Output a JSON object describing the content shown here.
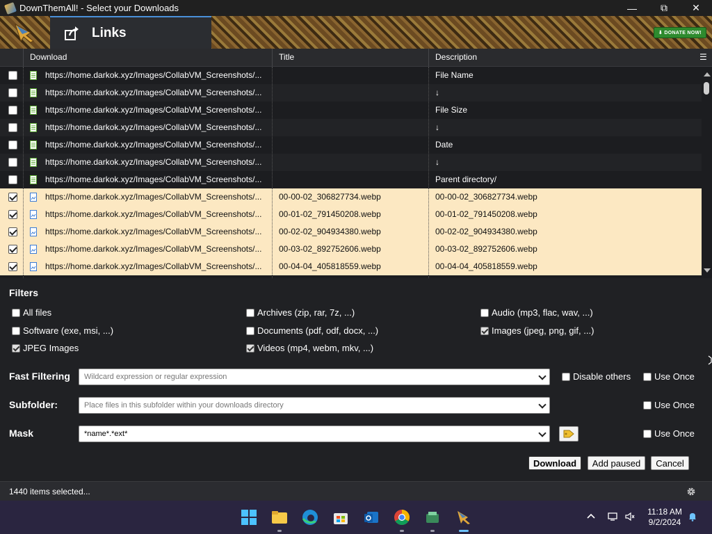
{
  "window": {
    "title": "DownThemAll! - Select your Downloads"
  },
  "banner": {
    "tab_label": "Links",
    "donate_label": "DONATE NOW!"
  },
  "table": {
    "columns": [
      "Download",
      "Title",
      "Description"
    ],
    "rows": [
      {
        "url": "https://home.darkok.xyz/Images/CollabVM_Screenshots/...",
        "title": "",
        "desc": "File Name",
        "checked": false,
        "type": "doc"
      },
      {
        "url": "https://home.darkok.xyz/Images/CollabVM_Screenshots/...",
        "title": "",
        "desc": "↓",
        "checked": false,
        "type": "doc"
      },
      {
        "url": "https://home.darkok.xyz/Images/CollabVM_Screenshots/...",
        "title": "",
        "desc": "File Size",
        "checked": false,
        "type": "doc"
      },
      {
        "url": "https://home.darkok.xyz/Images/CollabVM_Screenshots/...",
        "title": "",
        "desc": "↓",
        "checked": false,
        "type": "doc"
      },
      {
        "url": "https://home.darkok.xyz/Images/CollabVM_Screenshots/...",
        "title": "",
        "desc": "Date",
        "checked": false,
        "type": "doc"
      },
      {
        "url": "https://home.darkok.xyz/Images/CollabVM_Screenshots/...",
        "title": "",
        "desc": "↓",
        "checked": false,
        "type": "doc"
      },
      {
        "url": "https://home.darkok.xyz/Images/CollabVM_Screenshots/...",
        "title": "",
        "desc": "Parent directory/",
        "checked": false,
        "type": "doc"
      },
      {
        "url": "https://home.darkok.xyz/Images/CollabVM_Screenshots/...",
        "title": "00-00-02_306827734.webp",
        "desc": "00-00-02_306827734.webp",
        "checked": true,
        "type": "img"
      },
      {
        "url": "https://home.darkok.xyz/Images/CollabVM_Screenshots/...",
        "title": "00-01-02_791450208.webp",
        "desc": "00-01-02_791450208.webp",
        "checked": true,
        "type": "img"
      },
      {
        "url": "https://home.darkok.xyz/Images/CollabVM_Screenshots/...",
        "title": "00-02-02_904934380.webp",
        "desc": "00-02-02_904934380.webp",
        "checked": true,
        "type": "img"
      },
      {
        "url": "https://home.darkok.xyz/Images/CollabVM_Screenshots/...",
        "title": "00-03-02_892752606.webp",
        "desc": "00-03-02_892752606.webp",
        "checked": true,
        "type": "img"
      },
      {
        "url": "https://home.darkok.xyz/Images/CollabVM_Screenshots/...",
        "title": "00-04-04_405818559.webp",
        "desc": "00-04-04_405818559.webp",
        "checked": true,
        "type": "img"
      }
    ]
  },
  "filters": {
    "heading": "Filters",
    "items": [
      {
        "label": "All files",
        "checked": false
      },
      {
        "label": "Archives (zip, rar, 7z, ...)",
        "checked": false
      },
      {
        "label": "Audio (mp3, flac, wav, ...)",
        "checked": false
      },
      {
        "label": "Software (exe, msi, ...)",
        "checked": false
      },
      {
        "label": "Documents (pdf, odf, docx, ...)",
        "checked": false
      },
      {
        "label": "Images (jpeg, png, gif, ...)",
        "checked": true
      },
      {
        "label": "JPEG Images",
        "checked": true
      },
      {
        "label": "Videos (mp4, webm, mkv, ...)",
        "checked": true
      }
    ]
  },
  "fast_filtering": {
    "label": "Fast Filtering",
    "placeholder": "Wildcard expression or regular expression",
    "disable_others": "Disable others",
    "use_once": "Use Once"
  },
  "subfolder": {
    "label": "Subfolder:",
    "placeholder": "Place files in this subfolder within your downloads directory",
    "use_once": "Use Once"
  },
  "mask": {
    "label": "Mask",
    "value": "*name*.*ext*",
    "use_once": "Use Once"
  },
  "buttons": {
    "download": "Download",
    "add_paused": "Add paused",
    "cancel": "Cancel"
  },
  "status": {
    "text": "1440 items selected..."
  },
  "taskbar": {
    "time": "11:18 AM",
    "date": "9/2/2024"
  }
}
